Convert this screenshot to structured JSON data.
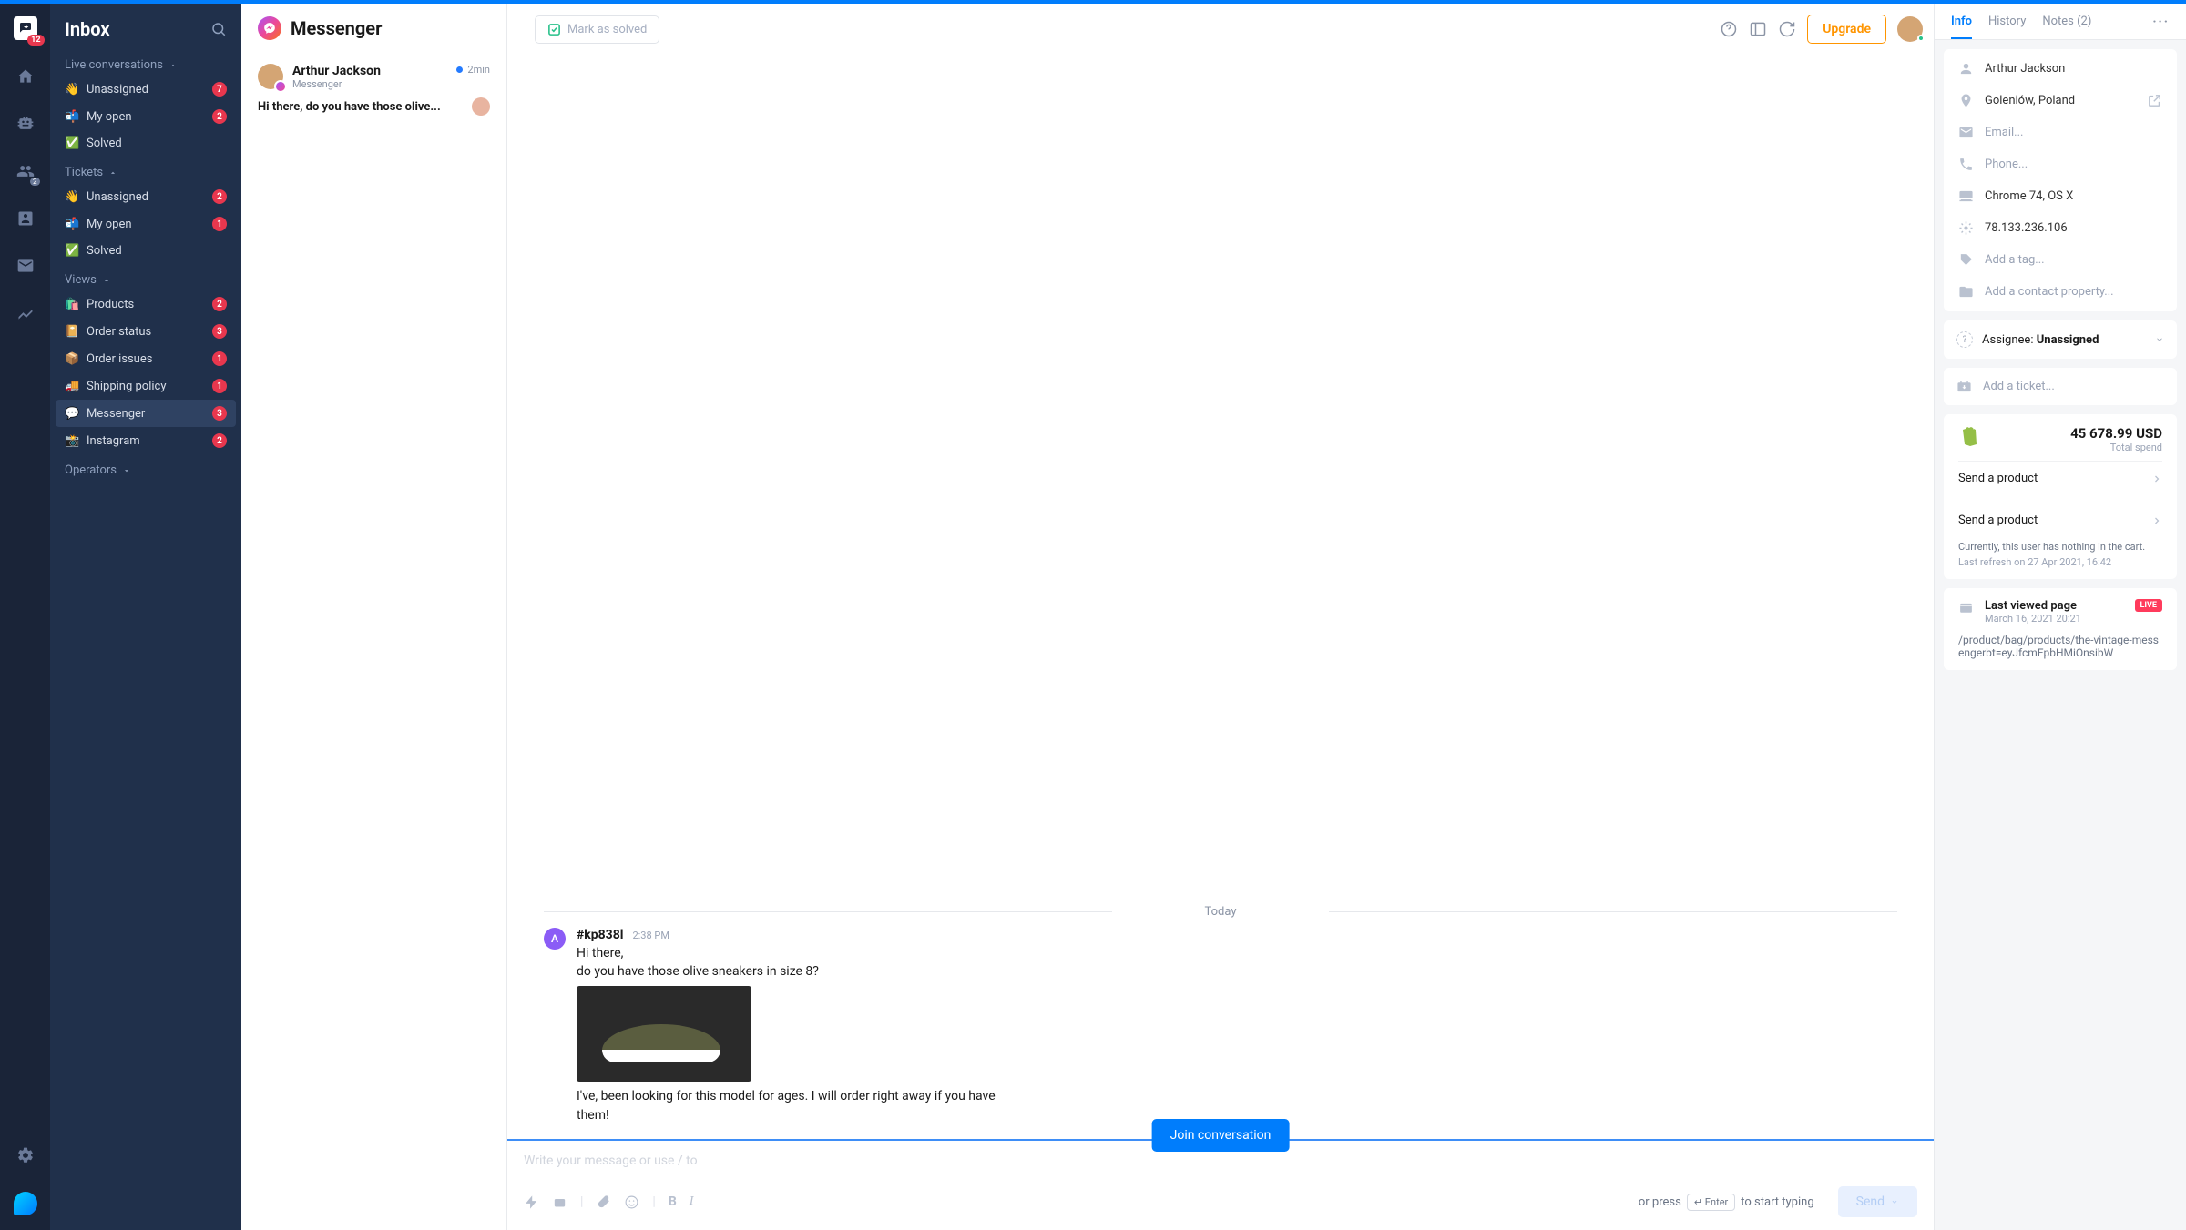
{
  "rail": {
    "logo_badge": "12",
    "people_badge": "2"
  },
  "sidebar": {
    "title": "Inbox",
    "sections": [
      {
        "title": "Live conversations",
        "items": [
          {
            "icon": "👋",
            "label": "Unassigned",
            "count": "7"
          },
          {
            "icon": "📬",
            "label": "My open",
            "count": "2"
          },
          {
            "icon": "✅",
            "label": "Solved",
            "count": null
          }
        ]
      },
      {
        "title": "Tickets",
        "items": [
          {
            "icon": "👋",
            "label": "Unassigned",
            "count": "2"
          },
          {
            "icon": "📬",
            "label": "My open",
            "count": "1"
          },
          {
            "icon": "✅",
            "label": "Solved",
            "count": null
          }
        ]
      },
      {
        "title": "Views",
        "items": [
          {
            "icon": "🛍️",
            "label": "Products",
            "count": "2"
          },
          {
            "icon": "📔",
            "label": "Order status",
            "count": "3"
          },
          {
            "icon": "📦",
            "label": "Order issues",
            "count": "1"
          },
          {
            "icon": "🚚",
            "label": "Shipping policy",
            "count": "1"
          },
          {
            "icon": "💬",
            "label": "Messenger",
            "count": "3",
            "active": true
          },
          {
            "icon": "📸",
            "label": "Instagram",
            "count": "2"
          }
        ]
      },
      {
        "title": "Operators",
        "items": []
      }
    ]
  },
  "clist": {
    "channel": "Messenger",
    "rows": [
      {
        "name": "Arthur Jackson",
        "source": "Messenger",
        "time": "2min",
        "preview": "Hi there, do you have those olive..."
      }
    ]
  },
  "topbar": {
    "solve": "Mark as solved",
    "upgrade": "Upgrade"
  },
  "chat": {
    "day": "Today",
    "msg": {
      "id": "#kp838l",
      "time": "2:38 PM",
      "avatar": "A",
      "text1": "Hi there,\ndo you have those olive sneakers in size 8?",
      "text2": "I've, been looking for this model for ages. I will order right away if you have them!"
    }
  },
  "composer": {
    "placeholder": "Write your message or use / to",
    "tip_pre": "or press",
    "key": "↵ Enter",
    "tip_post": "to start typing",
    "send": "Send",
    "join": "Join conversation"
  },
  "rpanel": {
    "tabs": [
      "Info",
      "History",
      "Notes (2)"
    ],
    "info": {
      "name": "Arthur Jackson",
      "location": "Goleniów, Poland",
      "email": "Email...",
      "phone": "Phone...",
      "device": "Chrome 74, OS X",
      "ip": "78.133.236.106",
      "tag": "Add a tag...",
      "prop": "Add a contact property..."
    },
    "assignee": {
      "label": "Assignee:",
      "value": "Unassigned"
    },
    "add_ticket": "Add a ticket...",
    "shop": {
      "amount": "45 678.99 USD",
      "amount_label": "Total spend",
      "action": "Send a product",
      "note": "Currently, this user has nothing in the cart.",
      "refresh": "Last refresh on 27 Apr 2021, 16:42"
    },
    "lvp": {
      "title": "Last viewed page",
      "date": "March 16, 2021 20:21",
      "live": "LIVE",
      "url": "/product/bag/products/the-vintage-messengerbt=eyJfcmFpbHMiOnsibW"
    }
  }
}
